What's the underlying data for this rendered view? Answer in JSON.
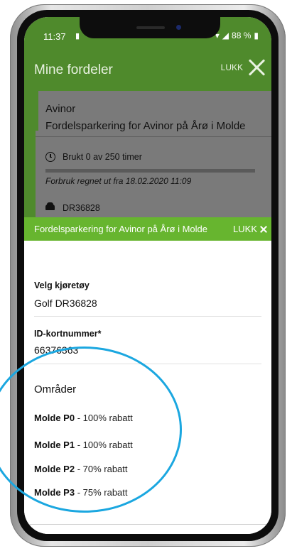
{
  "status_bar": {
    "time": "11:37",
    "sim_icon": "sim-card-icon",
    "battery": "88 %"
  },
  "header": {
    "title": "Mine fordeler",
    "close_label": "LUKK"
  },
  "card": {
    "title": "Avinor",
    "subtitle": "Fordelsparkering for Avinor på Årø i Molde",
    "usage": "Brukt 0 av 250 timer",
    "usage_fraction": 0,
    "usage_note": "Forbruk regnet ut fra 18.02.2020 11:09",
    "plate": "DR36828"
  },
  "sheet": {
    "title": "Fordelsparkering for Avinor på Årø i Molde",
    "close_label": "LUKK",
    "vehicle_label": "Velg kjøretøy",
    "vehicle_value": "Golf DR36828",
    "id_label": "ID-kortnummer*",
    "id_value": "66376363",
    "areas_title": "Områder",
    "areas": [
      {
        "name": "Molde P0",
        "discount": " - 100% rabatt"
      },
      {
        "name": "Molde P1",
        "discount": " - 100% rabatt"
      },
      {
        "name": "Molde P2",
        "discount": " - 70% rabatt"
      },
      {
        "name": "Molde P3",
        "discount": " - 75% rabatt"
      }
    ]
  },
  "colors": {
    "header_green": "#4f8a2c",
    "sheet_green": "#67b52f",
    "highlight_blue": "#1ba7e0"
  }
}
